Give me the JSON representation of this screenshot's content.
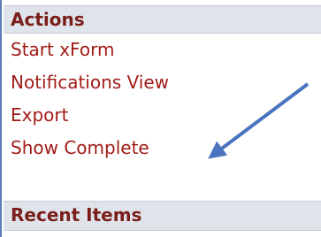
{
  "actions": {
    "header": "Actions",
    "items": [
      {
        "label": "Start xForm"
      },
      {
        "label": "Notifications View"
      },
      {
        "label": "Export"
      },
      {
        "label": "Show Complete"
      }
    ]
  },
  "recent": {
    "header": "Recent Items"
  },
  "colors": {
    "header_bg": "#dfe3ea",
    "header_text": "#7a1e19",
    "link": "#a01c18",
    "border": "#5b7fb5",
    "arrow": "#4a73c0"
  },
  "annotation": {
    "icon": "arrow-icon",
    "points_to": "Show Complete"
  }
}
